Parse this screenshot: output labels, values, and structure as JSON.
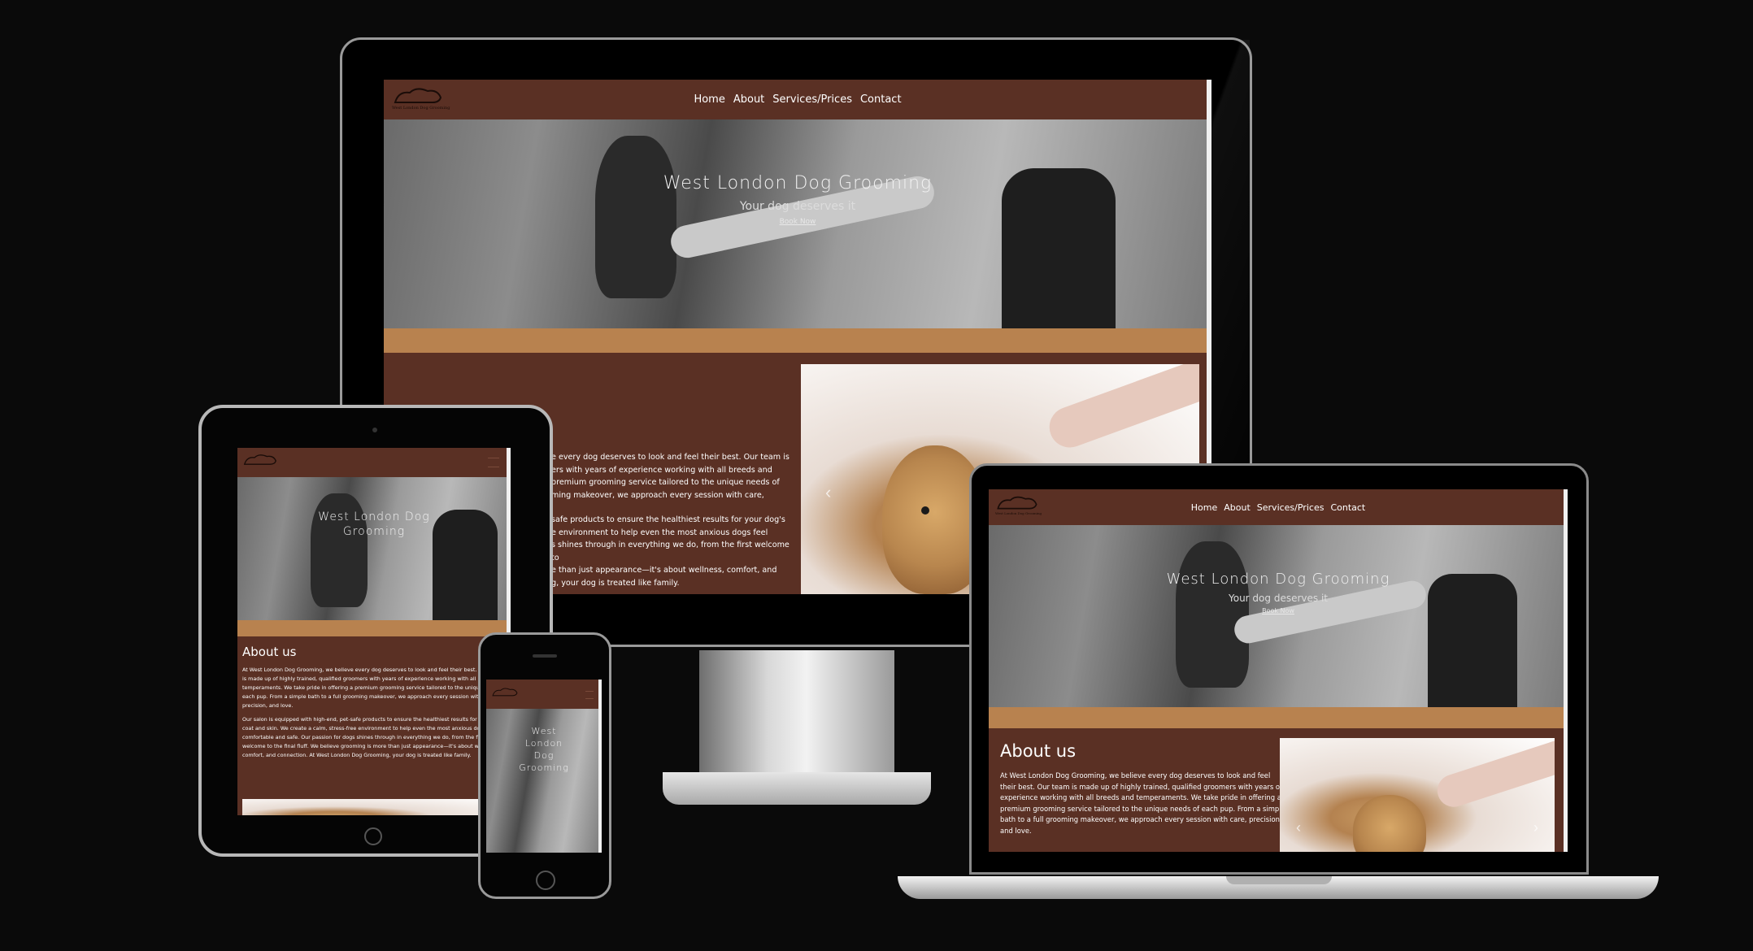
{
  "site": {
    "logo_text": "West London Dog Grooming",
    "nav": [
      "Home",
      "About",
      "Services/Prices",
      "Contact"
    ],
    "hero_title": "West London Dog Grooming",
    "hero_subtitle": "Your dog deserves it",
    "hero_button": "Book Now",
    "about_title": "About us",
    "about_p1": "At West London Dog Grooming, we believe every dog deserves to look and feel their best. Our team is made up of highly trained, qualified groomers with years of experience working with all breeds and temperaments. We take pride in offering a premium grooming service tailored to the unique needs of each pup. From a simple bath to a full grooming makeover, we approach every session with care, precision, and love.",
    "about_p2": "Our salon is equipped with high-end, pet-safe products to ensure the healthiest results for your dog's coat and skin. We create a calm, stress-free environment to help even the most anxious dogs feel comfortable and safe. Our passion for dogs shines through in everything we do, from the first welcome to the final fluff. We believe grooming is more than just appearance—it's about wellness, comfort, and connection. At West London Dog Grooming, your dog is treated like family."
  },
  "desktop_about_visible": [
    "e every dog deserves to look and feel their best. Our team is",
    "ers with years of experience working with all breeds and",
    "premium grooming service tailored to the unique needs of",
    "ming makeover, we approach every session with care,",
    "safe products to ensure the healthiest results for your dog's",
    "e environment to help even the most anxious dogs feel",
    "s shines through in everything we do, from the first welcome to",
    "e than just appearance—it's about wellness, comfort, and",
    "g, your dog is treated like family."
  ],
  "tablet_about_lines": [
    "At West London Dog Grooming, we believe every dog deserves to look and feel their best.",
    "is made up of highly trained, qualified groomers with years of experience working with all b",
    "temperaments. We take pride in offering a premium grooming service tailored to the uniqu",
    "each pup. From a simple bath to a full grooming makeover, we approach every session with c",
    "precision, and love.",
    "Our salon is equipped with high-end, pet-safe products to ensure the healthiest results for y",
    "coat and skin. We create a calm, stress-free environment to help even the most anxious dog",
    "comfortable and safe. Our passion for dogs shines through in everything we do, from the fi",
    "welcome to the final fluff. We believe grooming is more than just appearance—it's about we",
    "comfort, and connection. At West London Dog Grooming, your dog is treated like family."
  ],
  "laptop_about_lines": [
    "At West London Dog Grooming, we believe every dog deserves to look and feel",
    "their best. Our team is made up of highly trained, qualified groomers with years of",
    "experience working with all breeds and temperaments. We take pride in offering a",
    "premium grooming service tailored to the unique needs of each pup. From a simple",
    "bath to a full grooming makeover, we approach every session with care, precision,",
    "and love."
  ],
  "phone_hero_lines": [
    "West",
    "London",
    "Dog",
    "Grooming"
  ],
  "tablet_hero_lines": [
    "West London Dog",
    "Grooming"
  ],
  "carousel": {
    "prev": "‹",
    "next": "›"
  },
  "colors": {
    "brown": "#5a3024",
    "tan": "#b8824f",
    "background": "#0a0a0a"
  }
}
